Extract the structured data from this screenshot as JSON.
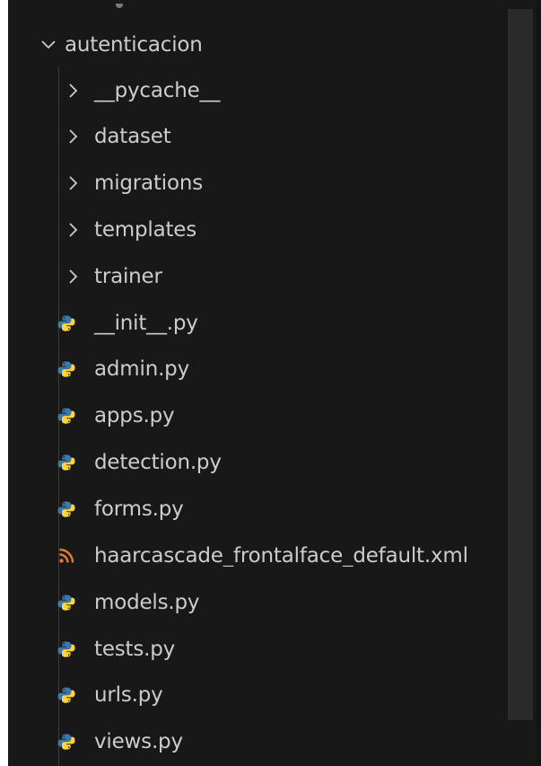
{
  "explorer": {
    "root_folder": {
      "label": "autenticacion",
      "expanded": true,
      "icon": "chevron-down-icon"
    },
    "subfolders": [
      {
        "label": "__pycache__",
        "icon": "chevron-right-icon"
      },
      {
        "label": "dataset",
        "icon": "chevron-right-icon"
      },
      {
        "label": "migrations",
        "icon": "chevron-right-icon"
      },
      {
        "label": "templates",
        "icon": "chevron-right-icon"
      },
      {
        "label": "trainer",
        "icon": "chevron-right-icon"
      }
    ],
    "files": [
      {
        "label": "__init__.py",
        "icon": "python-file-icon"
      },
      {
        "label": "admin.py",
        "icon": "python-file-icon"
      },
      {
        "label": "apps.py",
        "icon": "python-file-icon"
      },
      {
        "label": "detection.py",
        "icon": "python-file-icon"
      },
      {
        "label": "forms.py",
        "icon": "python-file-icon"
      },
      {
        "label": "haarcascade_frontalface_default.xml",
        "icon": "rss-xml-file-icon"
      },
      {
        "label": "models.py",
        "icon": "python-file-icon"
      },
      {
        "label": "tests.py",
        "icon": "python-file-icon"
      },
      {
        "label": "urls.py",
        "icon": "python-file-icon"
      },
      {
        "label": "views.py",
        "icon": "python-file-icon"
      }
    ]
  },
  "colors": {
    "background": "#181818",
    "text": "#cccccc",
    "python_blue": "#3c78aa",
    "python_yellow": "#ffd43b",
    "xml_orange": "#e37933"
  }
}
